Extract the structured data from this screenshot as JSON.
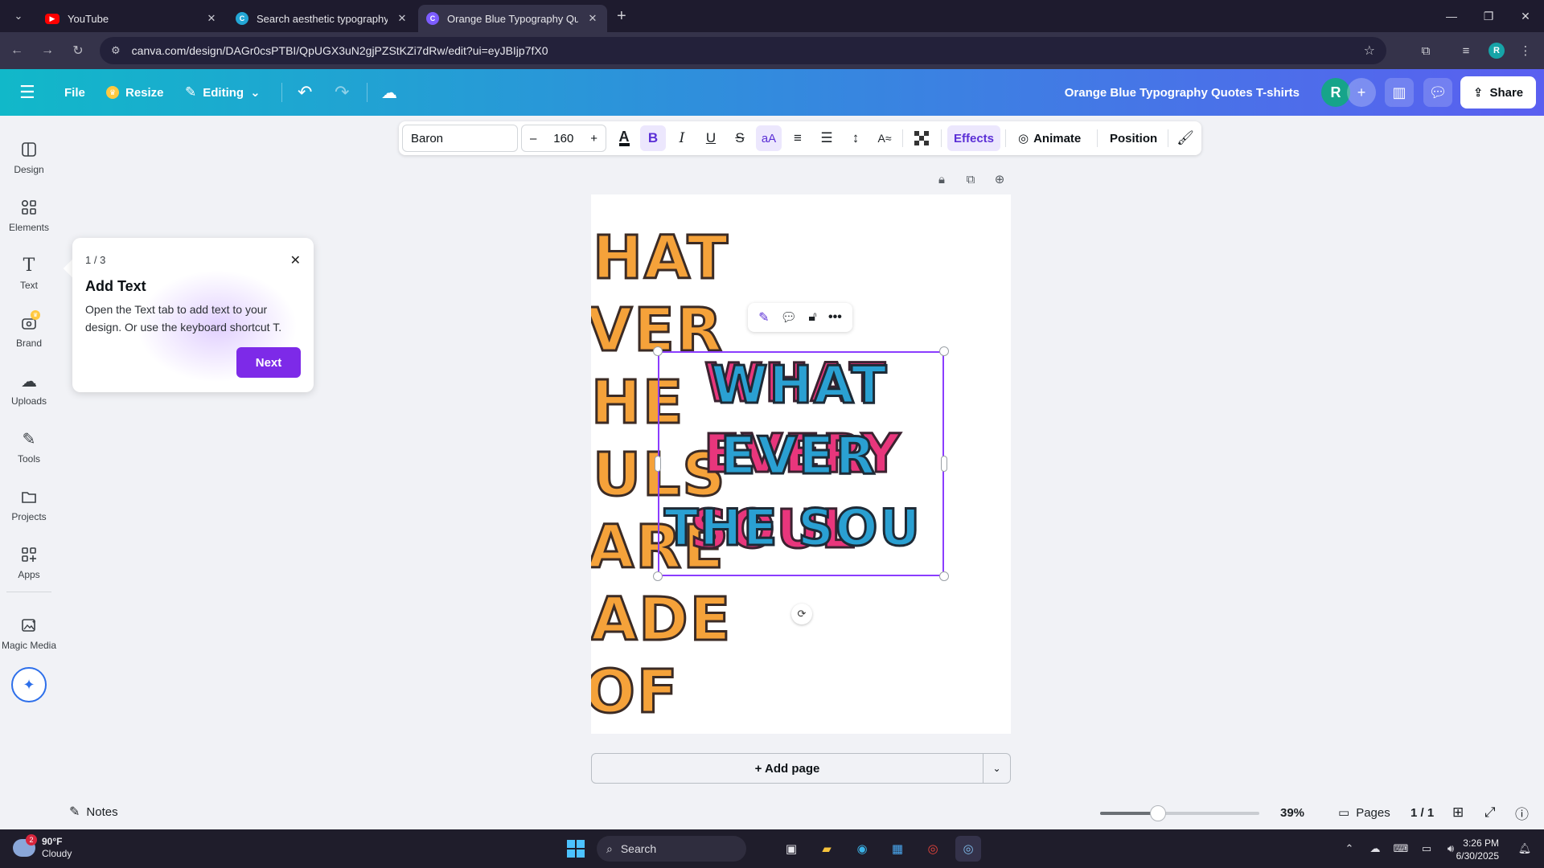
{
  "browser": {
    "tabs": [
      {
        "title": "YouTube",
        "icon": "youtube-icon"
      },
      {
        "title": "Search aesthetic typography po",
        "icon": "canva-icon"
      },
      {
        "title": "Orange Blue Typography Quote",
        "icon": "canva-icon"
      }
    ],
    "active_tab": 2,
    "url": "canva.com/design/DAGr0csPTBI/QpUGX3uN2gjPZStKZi7dRw/edit?ui=eyJBIjp7fX0",
    "profile_initial": "R"
  },
  "topbar": {
    "file": "File",
    "resize": "Resize",
    "editing": "Editing",
    "doc_title": "Orange Blue Typography Quotes T-shirts",
    "avatar_initial": "R",
    "share": "Share"
  },
  "sidebar": {
    "items": [
      {
        "label": "Design",
        "icon": "design-icon"
      },
      {
        "label": "Elements",
        "icon": "elements-icon"
      },
      {
        "label": "Text",
        "icon": "text-icon"
      },
      {
        "label": "Brand",
        "icon": "brand-icon"
      },
      {
        "label": "Uploads",
        "icon": "uploads-icon"
      },
      {
        "label": "Tools",
        "icon": "tools-icon"
      },
      {
        "label": "Projects",
        "icon": "projects-icon"
      },
      {
        "label": "Apps",
        "icon": "apps-icon"
      },
      {
        "label": "Magic Media",
        "icon": "magic-media-icon"
      }
    ]
  },
  "text_toolbar": {
    "font": "Baron",
    "minus": "–",
    "size": "160",
    "plus": "+",
    "effects": "Effects",
    "animate": "Animate",
    "position": "Position"
  },
  "canvas": {
    "background_words": [
      "HAT",
      "VER",
      "HE",
      "ULS",
      "ARE",
      "ADE",
      "OF"
    ],
    "pink_lines": [
      "WHAT",
      "EVERY",
      "SOUL"
    ],
    "blue_lines": [
      "WHAT",
      "EVER",
      "THE SOU"
    ],
    "accent_orange": "#f5a23a",
    "accent_pink": "#e8367c",
    "accent_blue": "#2aa0d2",
    "selection_color": "#8b3dff"
  },
  "popover": {
    "step": "1 / 3",
    "title": "Add Text",
    "body": "Open the Text tab to add text to your design. Or use the keyboard shortcut T.",
    "next": "Next"
  },
  "add_page": "+ Add page",
  "bottombar": {
    "notes": "Notes",
    "zoom": "39%",
    "zoom_level": 0.39,
    "pages_label": "Pages",
    "page_count": "1 / 1"
  },
  "taskbar": {
    "temperature": "90°F",
    "condition": "Cloudy",
    "weather_badge": "2",
    "search": "Search",
    "time": "3:26 PM",
    "date": "6/30/2025"
  }
}
